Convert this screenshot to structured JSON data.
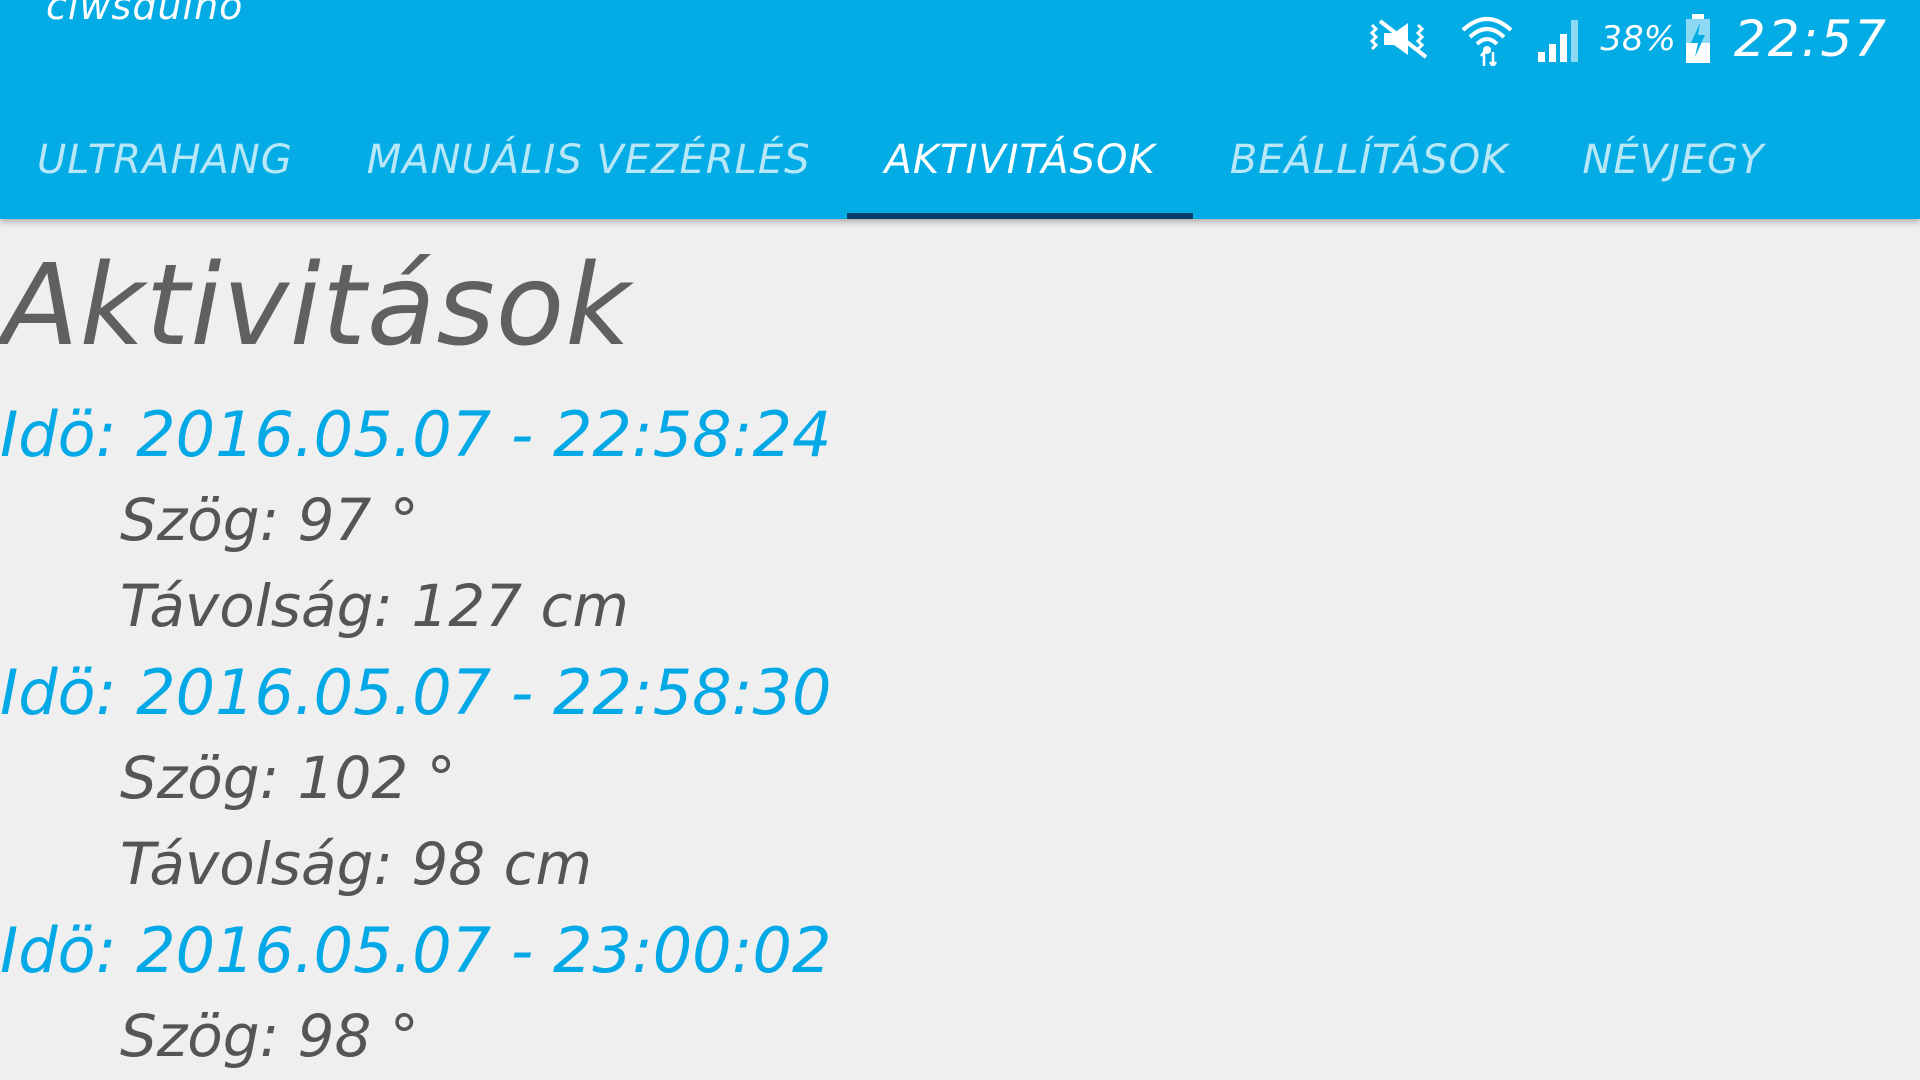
{
  "app": {
    "title": "ciwsduino"
  },
  "status_bar": {
    "icons": [
      "mute-vibrate-icon",
      "wifi-icon",
      "signal-icon",
      "battery-charging-icon"
    ],
    "battery_percent": "38%",
    "clock": "22:57",
    "icon_color": "#ffffff"
  },
  "tabs": [
    {
      "label": "ULTRAHANG",
      "active": false
    },
    {
      "label": "MANUÁLIS VEZÉRLÉS",
      "active": false
    },
    {
      "label": "AKTIVITÁSOK",
      "active": true
    },
    {
      "label": "BEÁLLÍTÁSOK",
      "active": false
    },
    {
      "label": "NÉVJEGY",
      "active": false
    }
  ],
  "page": {
    "title": "Aktivitások"
  },
  "activities": [
    {
      "time": "Idö: 2016.05.07 - 22:58:24",
      "angle": "Szög: 97 °",
      "distance": "Távolság: 127 cm"
    },
    {
      "time": "Idö: 2016.05.07 - 22:58:30",
      "angle": "Szög: 102 °",
      "distance": "Távolság: 98 cm"
    },
    {
      "time": "Idö: 2016.05.07 - 23:00:02",
      "angle": "Szög: 98 °",
      "distance": ""
    }
  ],
  "colors": {
    "appbar": "#03ace5",
    "tab_indicator": "#023e6e",
    "background": "#efefef",
    "timestamp": "#03a8e6",
    "title_text": "#606060",
    "body_text": "#555555"
  }
}
